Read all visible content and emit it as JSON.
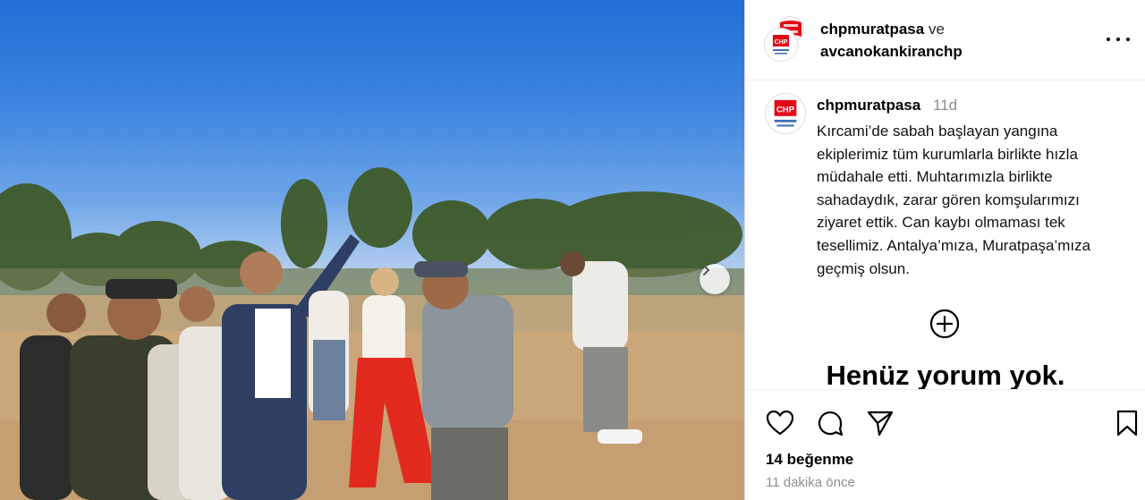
{
  "colors": {
    "text_primary": "#000000",
    "text_secondary": "#8e8e8e",
    "divider": "#dbdbdb",
    "logo_red": "#e30a17"
  },
  "media": {
    "next_icon": "chevron-right-icon"
  },
  "header": {
    "user1": "chpmuratpasa",
    "conjunction": "ve",
    "user2": "avcanokankiranchp",
    "more_icon": "more-horizontal-icon"
  },
  "caption": {
    "username": "chpmuratpasa",
    "time_ago": "11d",
    "lines": [
      "Kırcami’de sabah başlayan yangına",
      "ekiplerimiz tüm kurumlarla birlikte hızla",
      "müdahale etti. Muhtarımızla birlikte",
      "sahadaydık, zarar gören komşularımızı",
      "ziyaret ettik. Can kaybı olmaması tek",
      "tesellimiz. Antalya’mıza, Muratpaşa’mıza",
      "geçmiş olsun."
    ]
  },
  "comments": {
    "add_icon": "add-circle-icon",
    "empty_text": "Henüz yorum yok."
  },
  "actions": {
    "like_icon": "heart-icon",
    "comment_icon": "comment-icon",
    "share_icon": "send-icon",
    "save_icon": "bookmark-icon",
    "likes_text": "14 beğenme",
    "time_text": "11 dakika önce"
  }
}
